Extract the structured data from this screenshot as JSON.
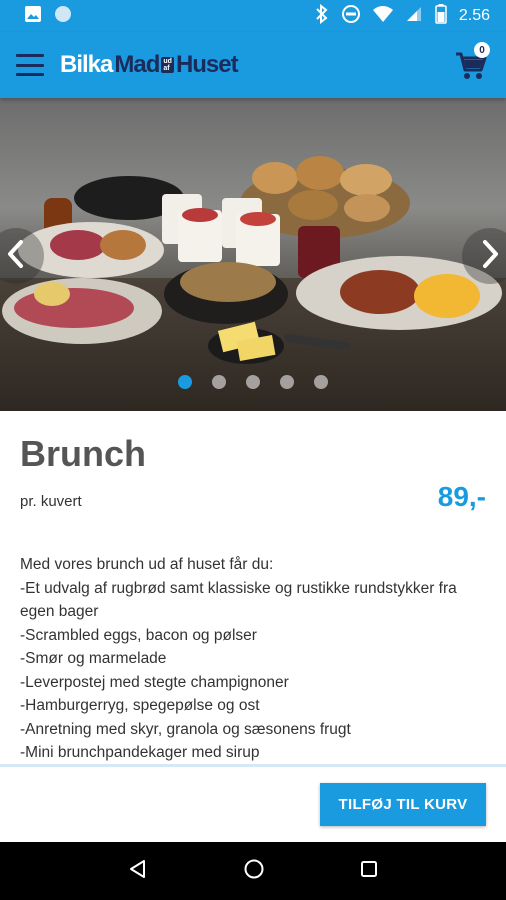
{
  "status": {
    "time": "2.56"
  },
  "header": {
    "logo_bilka": "Bilka",
    "logo_mad": "Mad",
    "logo_ud": "ud",
    "logo_af": "af",
    "logo_huset": "Huset",
    "cart_count": "0",
    "brand_color": "#1a9be0"
  },
  "carousel": {
    "slide_count": 5,
    "active_index": 0
  },
  "product": {
    "title": "Brunch",
    "unit": "pr. kuvert",
    "price": "89,-",
    "description": [
      "Med vores brunch ud af huset får du:",
      "-Et udvalg af rugbrød samt klassiske og rustikke rundstykker fra egen bager",
      "-Scrambled eggs, bacon og pølser",
      "-Smør og marmelade",
      "-Leverpostej med stegte champignoner",
      "-Hamburgerryg, spegepølse og ost",
      "-Anretning med skyr, granola og sæsonens frugt",
      "-Mini brunchpandekager med sirup"
    ]
  },
  "footer": {
    "add_label": "TILFØJ TIL KURV"
  }
}
